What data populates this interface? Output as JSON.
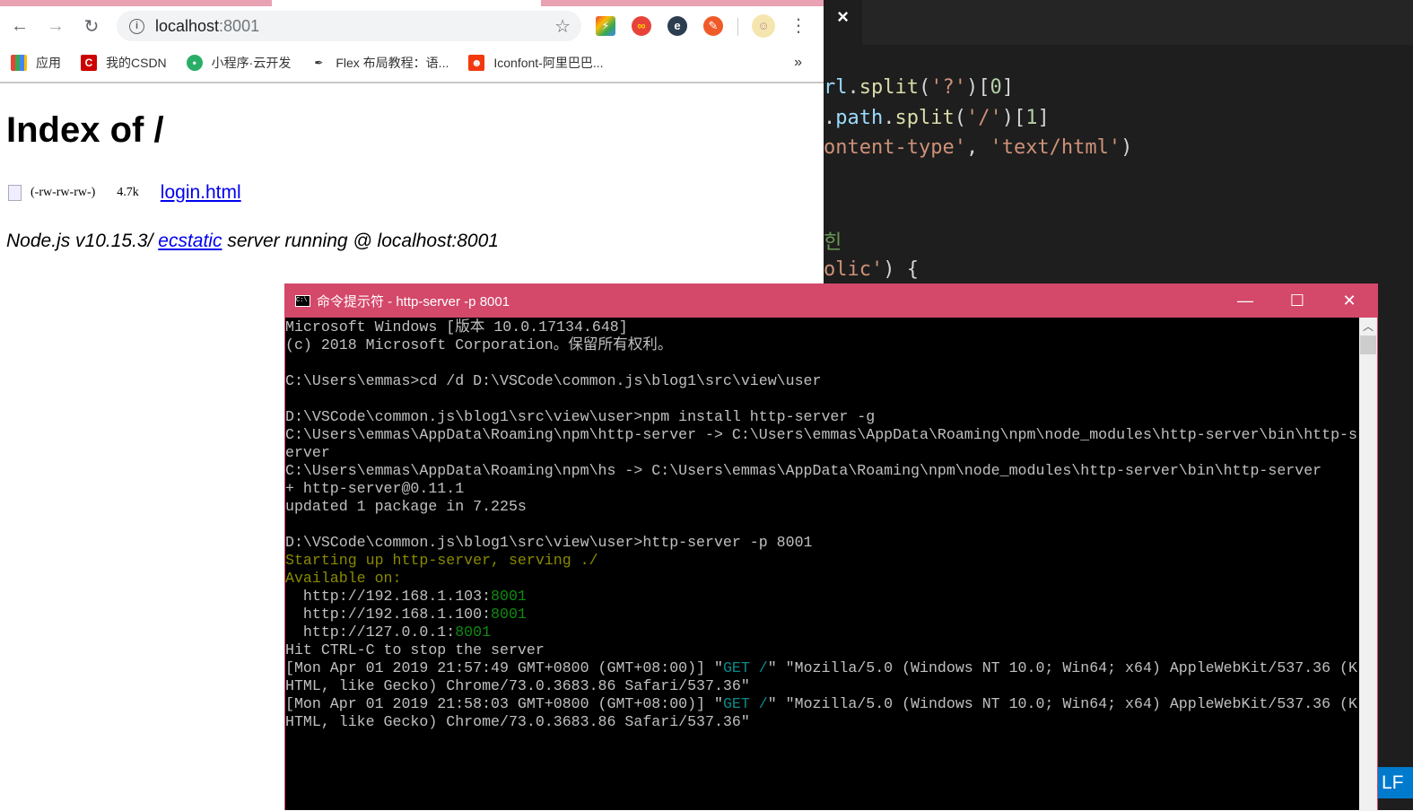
{
  "browser": {
    "url_host": "localhost",
    "url_port": ":8001",
    "bookmarks": [
      {
        "label": "应用",
        "icon": "apps-grid-icon"
      },
      {
        "label": "我的CSDN",
        "icon": "csdn-icon"
      },
      {
        "label": "小程序·云开发",
        "icon": "wechat-icon"
      },
      {
        "label": "Flex 布局教程：语...",
        "icon": "calligraphy-icon"
      },
      {
        "label": "Iconfont-阿里巴巴...",
        "icon": "iconfont-icon"
      }
    ],
    "more_bookmarks": "»",
    "page": {
      "title": "Index of /",
      "file_perms": "(-rw-rw-rw-)",
      "file_size": "4.7k",
      "file_link": "login.html",
      "footer_pre": "Node.js v10.15.3/ ",
      "footer_link": "ecstatic",
      "footer_post": " server running @ localhost:8001"
    }
  },
  "vscode": {
    "tab_close": "×",
    "status_eol": "LF"
  },
  "cmd": {
    "title": "命令提示符 - http-server  -p 8001",
    "colors": {
      "default": "#c0c0c0",
      "yellow": "#8a8a00",
      "green": "#0f8a0f",
      "teal": "#0a8a8a",
      "titlebar": "#d4486a"
    },
    "lines": [
      [
        {
          "t": "Microsoft Windows [版本 10.0.17134.648]"
        }
      ],
      [
        {
          "t": "(c) 2018 Microsoft Corporation。保留所有权利。"
        }
      ],
      [
        {
          "t": ""
        }
      ],
      [
        {
          "t": "C:\\Users\\emmas>cd /d D:\\VSCode\\common.js\\blog1\\src\\view\\user"
        }
      ],
      [
        {
          "t": ""
        }
      ],
      [
        {
          "t": "D:\\VSCode\\common.js\\blog1\\src\\view\\user>npm install http-server -g"
        }
      ],
      [
        {
          "t": "C:\\Users\\emmas\\AppData\\Roaming\\npm\\http-server -> C:\\Users\\emmas\\AppData\\Roaming\\npm\\node_modules\\http-server\\bin\\http-s"
        }
      ],
      [
        {
          "t": "erver"
        }
      ],
      [
        {
          "t": "C:\\Users\\emmas\\AppData\\Roaming\\npm\\hs -> C:\\Users\\emmas\\AppData\\Roaming\\npm\\node_modules\\http-server\\bin\\http-server"
        }
      ],
      [
        {
          "t": "+ http-server@0.11.1"
        }
      ],
      [
        {
          "t": "updated 1 package in 7.225s"
        }
      ],
      [
        {
          "t": ""
        }
      ],
      [
        {
          "t": "D:\\VSCode\\common.js\\blog1\\src\\view\\user>http-server -p 8001"
        }
      ],
      [
        {
          "t": "Starting up http-server, serving ./",
          "c": "yellow"
        }
      ],
      [
        {
          "t": "Available on:",
          "c": "yellow"
        }
      ],
      [
        {
          "t": "  http://192.168.1.103:"
        },
        {
          "t": "8001",
          "c": "green"
        }
      ],
      [
        {
          "t": "  http://192.168.1.100:"
        },
        {
          "t": "8001",
          "c": "green"
        }
      ],
      [
        {
          "t": "  http://127.0.0.1:"
        },
        {
          "t": "8001",
          "c": "green"
        }
      ],
      [
        {
          "t": "Hit CTRL-C to stop the server"
        }
      ],
      [
        {
          "t": "[Mon Apr 01 2019 21:57:49 GMT+0800 (GMT+08:00)] \""
        },
        {
          "t": "GET /",
          "c": "teal"
        },
        {
          "t": "\" \"Mozilla/5.0 (Windows NT 10.0; Win64; x64) AppleWebKit/537.36 (K"
        }
      ],
      [
        {
          "t": "HTML, like Gecko) Chrome/73.0.3683.86 Safari/537.36\""
        }
      ],
      [
        {
          "t": "[Mon Apr 01 2019 21:58:03 GMT+0800 (GMT+08:00)] \""
        },
        {
          "t": "GET /",
          "c": "teal"
        },
        {
          "t": "\" \"Mozilla/5.0 (Windows NT 10.0; Win64; x64) AppleWebKit/537.36 (K"
        }
      ],
      [
        {
          "t": "HTML, like Gecko) Chrome/73.0.3683.86 Safari/537.36\""
        }
      ]
    ]
  },
  "code_lines": [
    "rl.split('?')[0]",
    ".path.split('/')[1]",
    "ontent-type', 'text/html')",
    "",
    "",
    "힌",
    "olic') {"
  ]
}
